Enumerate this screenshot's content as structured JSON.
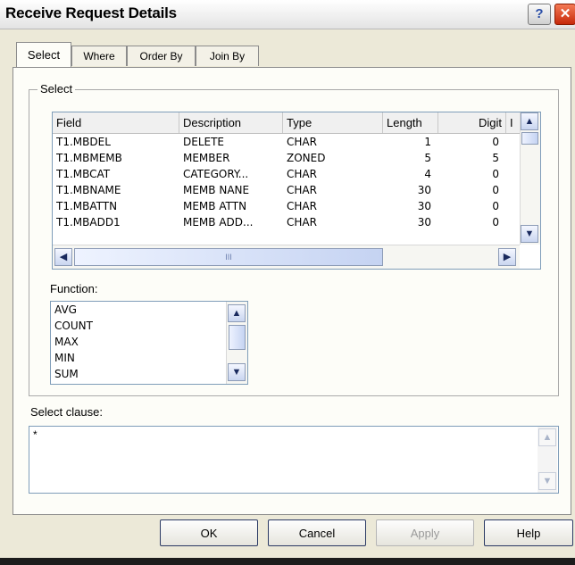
{
  "window": {
    "title": "Receive Request Details",
    "help_glyph": "?",
    "close_glyph": "✕"
  },
  "tabs": [
    {
      "label": "Select"
    },
    {
      "label": "Where"
    },
    {
      "label": "Order By"
    },
    {
      "label": "Join By"
    }
  ],
  "select_group": {
    "label": "Select"
  },
  "fields_table": {
    "columns": [
      "Field",
      "Description",
      "Type",
      "Length",
      "Digit",
      "I"
    ],
    "rows": [
      {
        "field": "T1.MBDEL",
        "description": "DELETE",
        "type": "CHAR",
        "length": "1",
        "digit": "0"
      },
      {
        "field": "T1.MBMEMB",
        "description": "MEMBER",
        "type": "ZONED",
        "length": "5",
        "digit": "5"
      },
      {
        "field": "T1.MBCAT",
        "description": "CATEGORY...",
        "type": "CHAR",
        "length": "4",
        "digit": "0"
      },
      {
        "field": "T1.MBNAME",
        "description": "MEMB NANE",
        "type": "CHAR",
        "length": "30",
        "digit": "0"
      },
      {
        "field": "T1.MBATTN",
        "description": "MEMB ATTN",
        "type": "CHAR",
        "length": "30",
        "digit": "0"
      },
      {
        "field": "T1.MBADD1",
        "description": "MEMB ADD...",
        "type": "CHAR",
        "length": "30",
        "digit": "0"
      }
    ]
  },
  "function": {
    "label": "Function:",
    "items": [
      "AVG",
      "COUNT",
      "MAX",
      "MIN",
      "SUM"
    ]
  },
  "select_clause": {
    "label": "Select clause:",
    "value": "*"
  },
  "buttons": {
    "ok": "OK",
    "cancel": "Cancel",
    "apply": "Apply",
    "help": "Help"
  },
  "icons": {
    "up": "▲",
    "down": "▼",
    "left": "◀",
    "right": "▶",
    "grip": "III"
  }
}
